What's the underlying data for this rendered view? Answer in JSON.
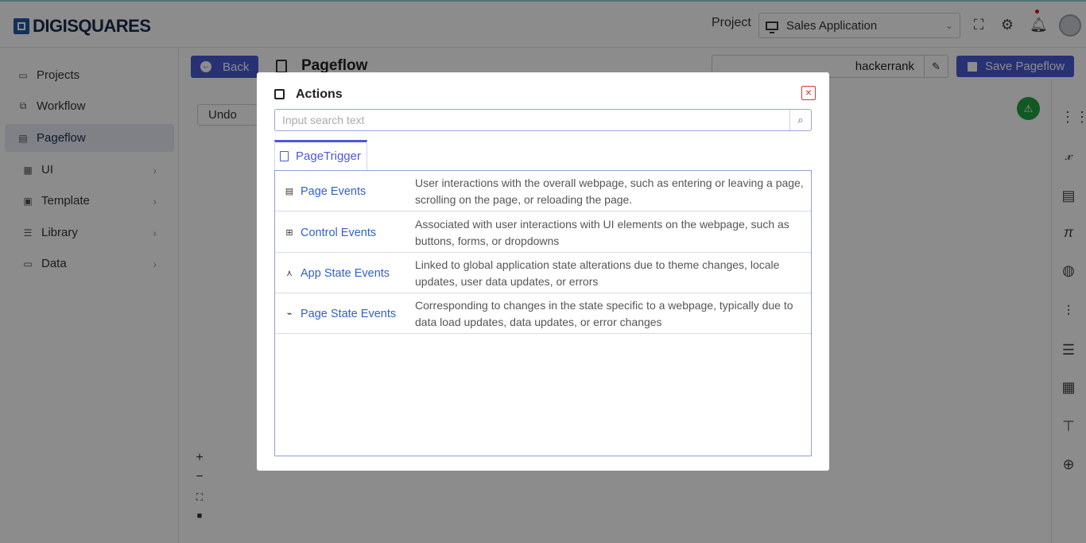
{
  "header": {
    "logo_text": "DIGISQUARES",
    "project_label": "Project",
    "project_value": "Sales Application"
  },
  "sidebar": {
    "items": [
      {
        "label": "Projects",
        "icon": "folder-icon",
        "active": false,
        "has_arrow": false
      },
      {
        "label": "Workflow",
        "icon": "workflow-icon",
        "active": false,
        "has_arrow": false
      },
      {
        "label": "Pageflow",
        "icon": "page-icon",
        "active": true,
        "has_arrow": false
      },
      {
        "label": "UI",
        "icon": "ui-icon",
        "active": false,
        "has_arrow": true
      },
      {
        "label": "Template",
        "icon": "template-icon",
        "active": false,
        "has_arrow": true
      },
      {
        "label": "Library",
        "icon": "library-icon",
        "active": false,
        "has_arrow": true
      },
      {
        "label": "Data",
        "icon": "data-icon",
        "active": false,
        "has_arrow": true
      }
    ]
  },
  "toolbar": {
    "back_label": "Back",
    "page_title": "Pageflow",
    "name_value": "hackerrank",
    "save_label": "Save Pageflow",
    "undo_label": "Undo"
  },
  "modal": {
    "title": "Actions",
    "search_placeholder": "Input search text",
    "tab_label": "PageTrigger",
    "rows": [
      {
        "name": "Page Events",
        "icon": "page-events-icon",
        "desc": "User interactions with the overall webpage, such as entering or leaving a page, scrolling on the page, or reloading the page."
      },
      {
        "name": "Control Events",
        "icon": "control-events-icon",
        "desc": "Associated with user interactions with UI elements on the webpage, such as buttons, forms, or dropdowns"
      },
      {
        "name": "App State Events",
        "icon": "app-state-icon",
        "desc": "Linked to global application state alterations due to theme changes, locale updates, user data updates, or errors"
      },
      {
        "name": "Page State Events",
        "icon": "page-state-icon",
        "desc": "Corresponding to changes in the state specific to a webpage, typically due to data load updates, data updates, or error changes"
      }
    ]
  },
  "colors": {
    "accent": "#4a5ad4",
    "link": "#2f62c8",
    "warning_badge": "#1fa140",
    "close": "#d33333"
  }
}
